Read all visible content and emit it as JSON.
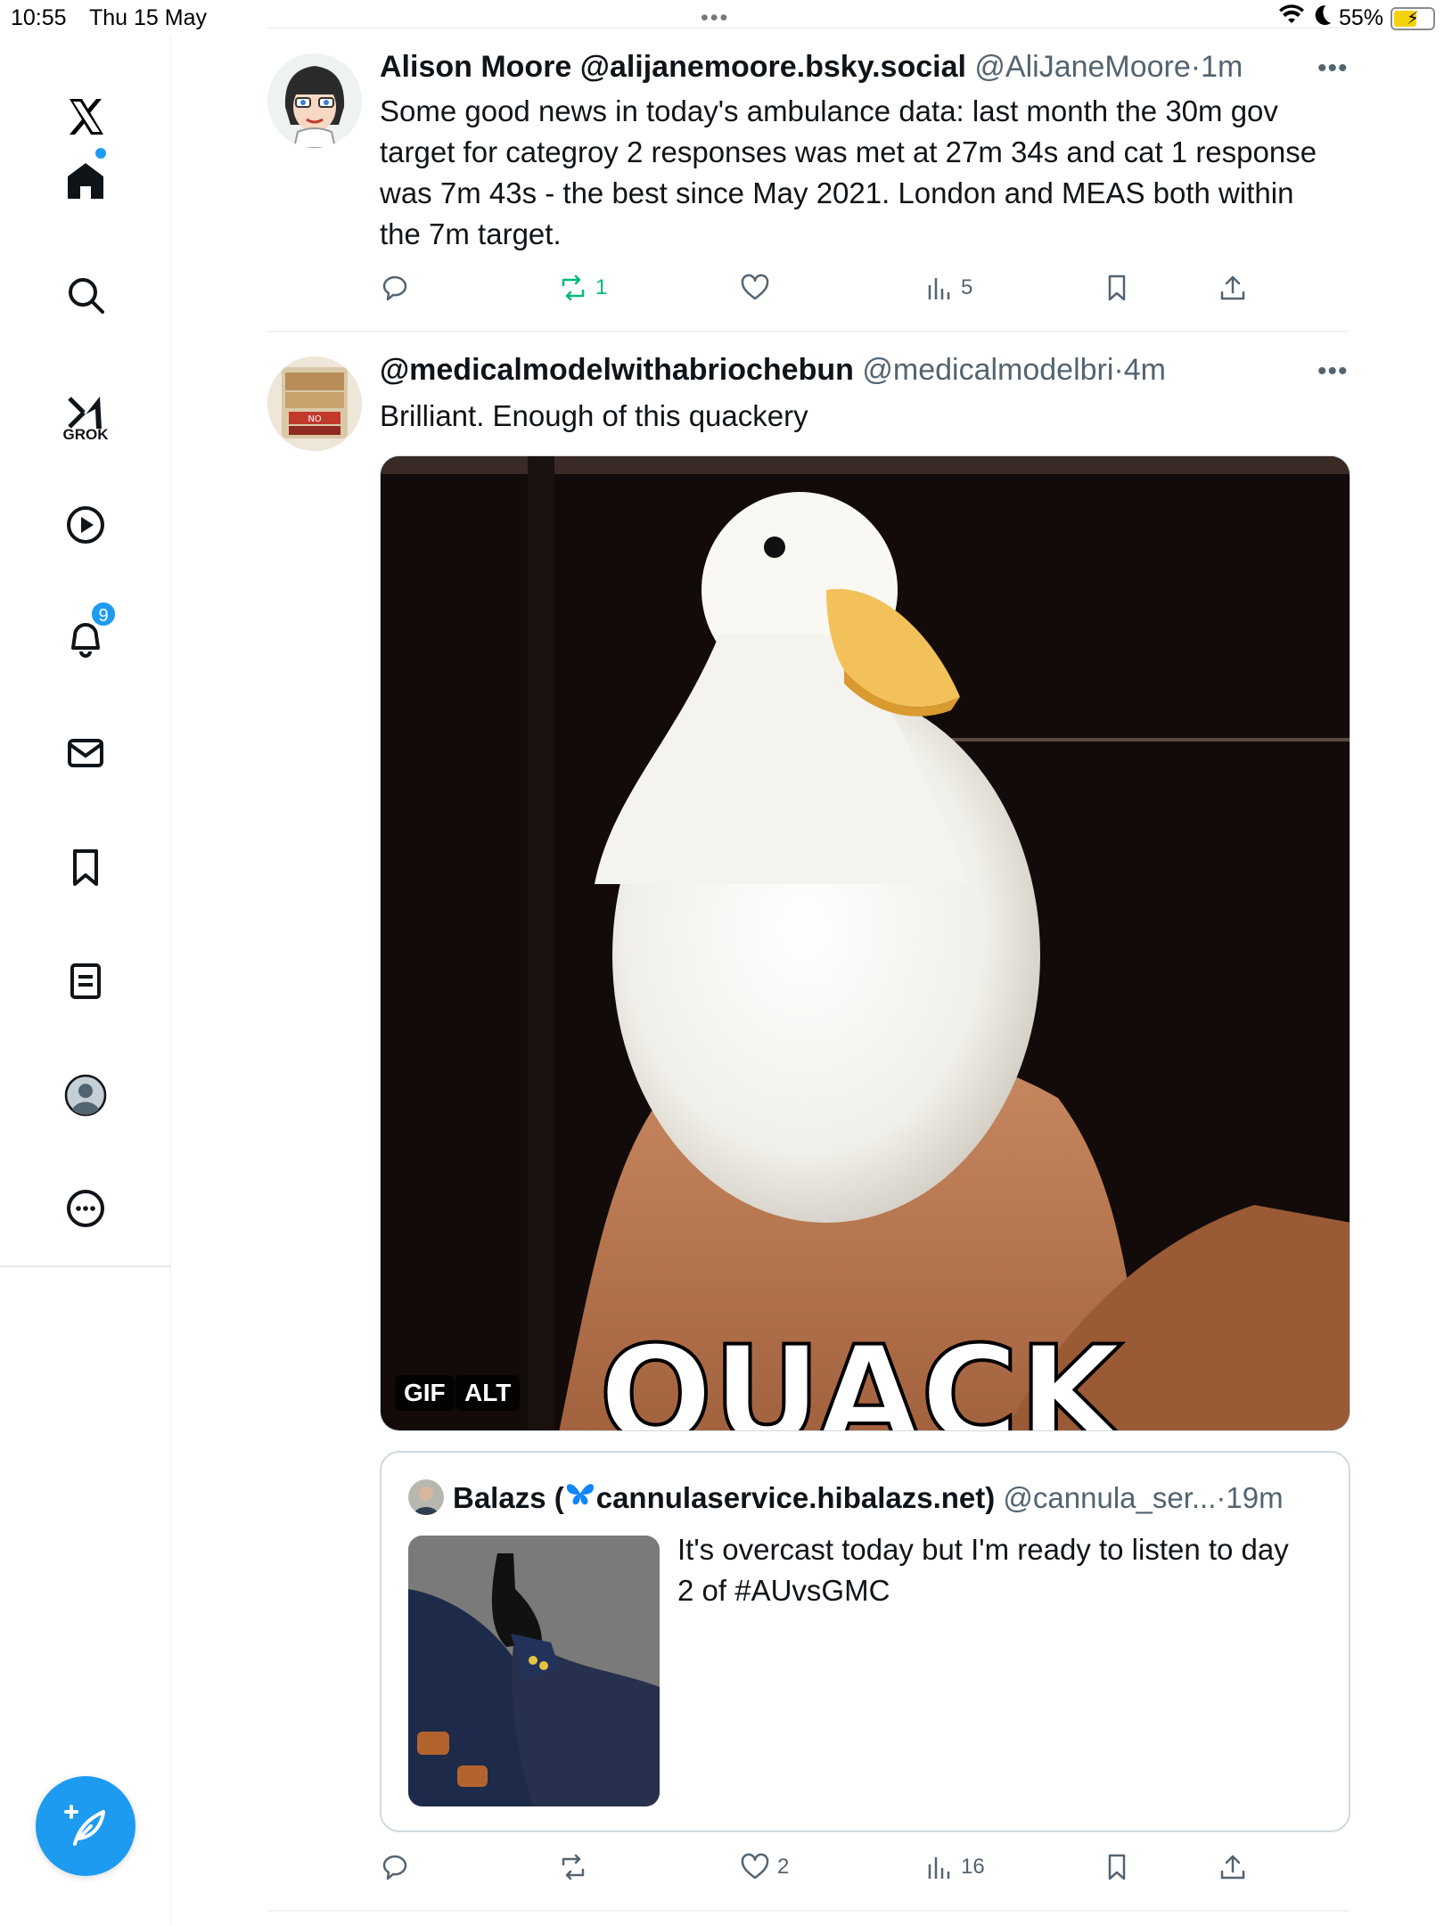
{
  "status_bar": {
    "time": "10:55",
    "date": "Thu 15 May",
    "battery": "55%",
    "multitask": "•••"
  },
  "sidebar": {
    "items": [
      {
        "name": "x-logo"
      },
      {
        "name": "home"
      },
      {
        "name": "search"
      },
      {
        "name": "grok",
        "label": "GROK"
      },
      {
        "name": "videos"
      },
      {
        "name": "notifications",
        "badge": "9"
      },
      {
        "name": "messages"
      },
      {
        "name": "bookmarks"
      },
      {
        "name": "lists"
      },
      {
        "name": "profile"
      },
      {
        "name": "more"
      }
    ]
  },
  "posts": [
    {
      "author": "Alison Moore @alijanemoore.bsky.social",
      "handle": "@AliJaneMoore",
      "time": "1m",
      "text_lines": [
        "Some good news in today's ambulance data: last month the 30m gov",
        "target for categroy 2 responses was met at 27m 34s and cat 1 response",
        "was 7m 43s - the best since May 2021. London and MEAS both within",
        "the 7m target."
      ],
      "retweets": "1",
      "views": "5"
    },
    {
      "author": "@medicalmodelwithabriochebun",
      "handle": "@medicalmodelbri",
      "time": "4m",
      "text": "Brilliant. Enough of this quackery",
      "media_tags": [
        "GIF",
        "ALT"
      ],
      "gif_caption": "QUACK",
      "likes": "2",
      "views": "16",
      "quote": {
        "author_prefix": "Balazs (",
        "author_suffix": "cannulaservice.hibalazs.net)",
        "handle": "@cannula_ser...",
        "time": "19m",
        "text_lines": [
          "It's overcast today but I'm ready to listen to day",
          "2 of #AUvsGMC"
        ]
      }
    }
  ],
  "colors": {
    "accent": "#1d9bf0",
    "retweet_green": "#00ba7c",
    "secondary_text": "#536471"
  }
}
